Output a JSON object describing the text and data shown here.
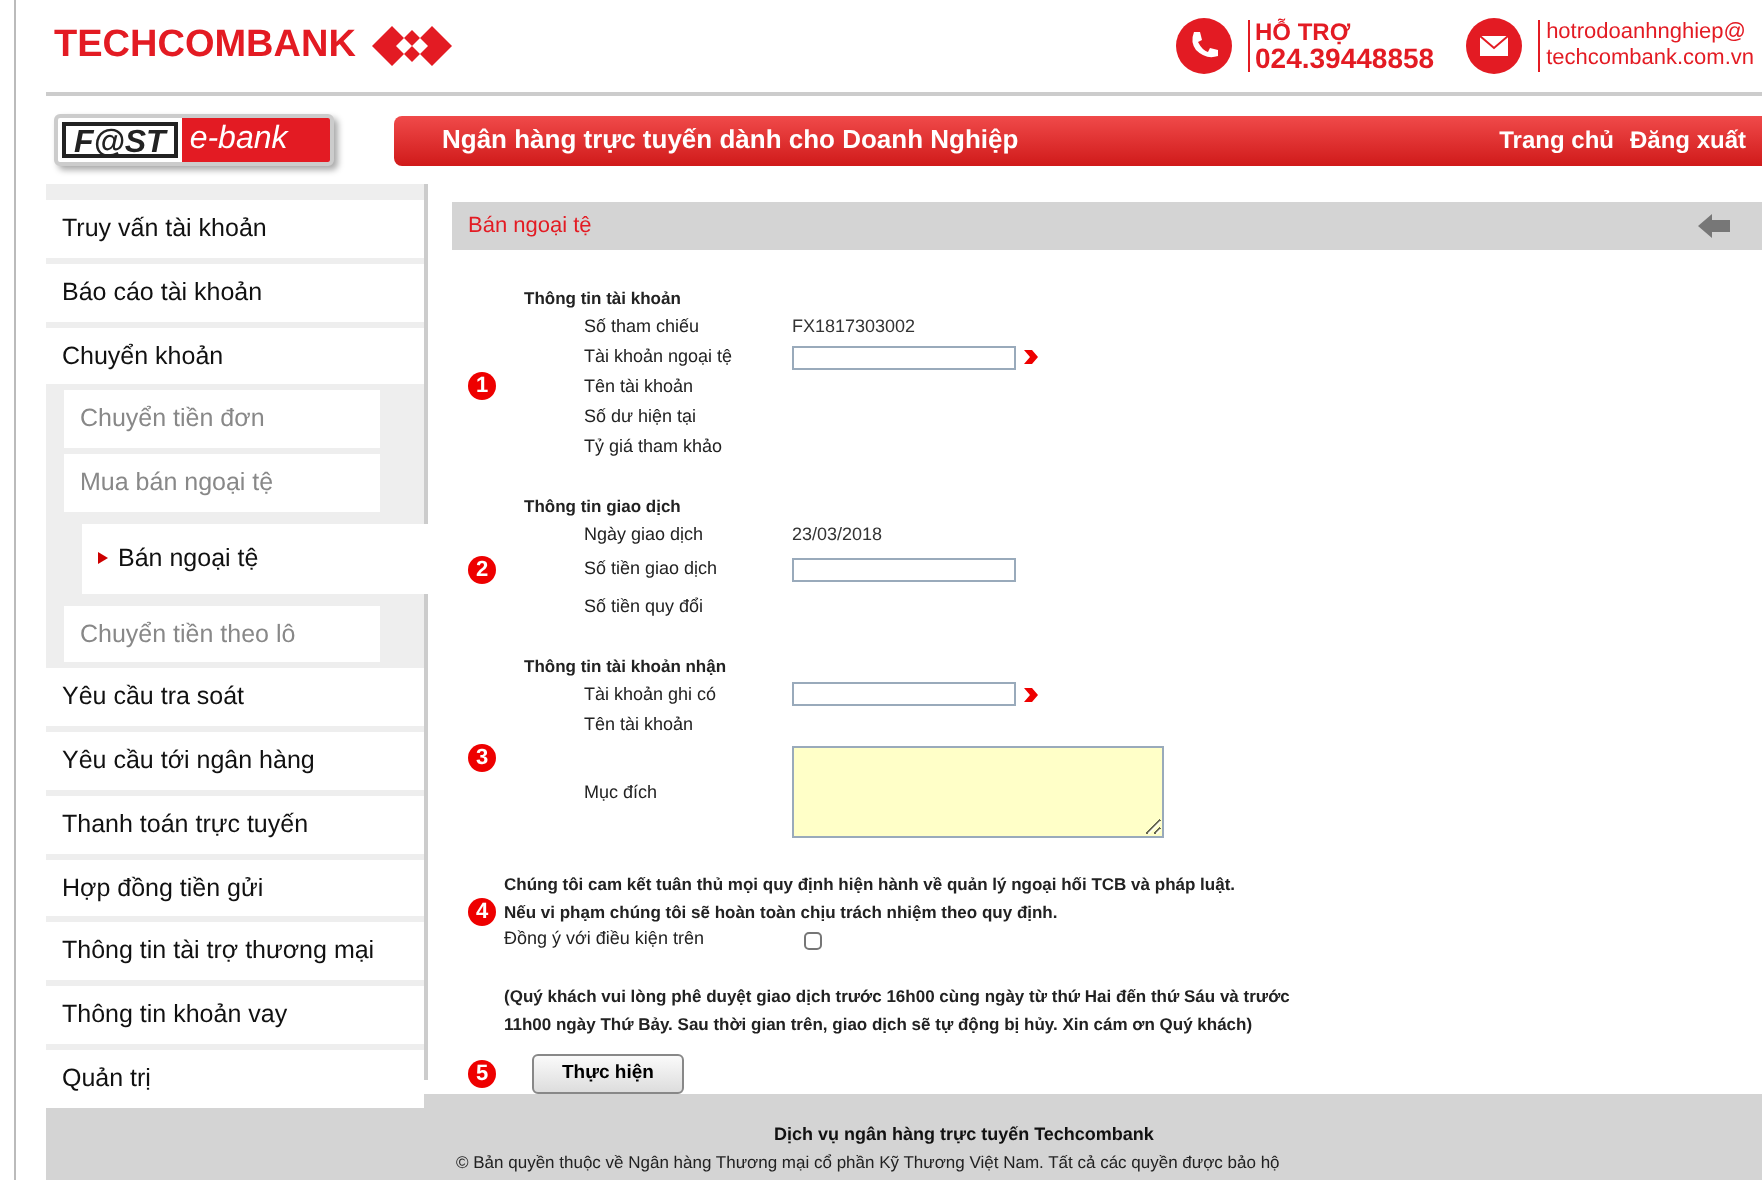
{
  "header": {
    "bank_name": "TECHCOMBANK",
    "support_label": "HỖ TRỢ",
    "support_phone": "024.39448858",
    "email_line_1": "hotrodoanhnghiep@",
    "email_line_2": "techcombank.com.vn"
  },
  "banner": {
    "logo_left": "F@ST",
    "logo_right": "e-bank",
    "tagline": "Ngân hàng trực tuyến dành cho Doanh Nghiệp",
    "links": [
      "Trang chủ",
      "Đăng xuất"
    ]
  },
  "sidebar": {
    "items": [
      {
        "label": "Truy vấn tài khoản",
        "selected": false
      },
      {
        "label": "Báo cáo tài khoản",
        "selected": false
      },
      {
        "label": "Chuyển khoản",
        "selected": false,
        "children": [
          {
            "label": "Chuyển tiền đơn",
            "selected": false
          },
          {
            "label": "Mua bán ngoại tệ",
            "selected": false,
            "children": [
              {
                "label": "Bán ngoại tệ",
                "selected": true
              }
            ]
          },
          {
            "label": "Chuyển tiền theo lô",
            "selected": false
          }
        ]
      },
      {
        "label": "Yêu cầu tra soát",
        "selected": false
      },
      {
        "label": "Yêu cầu tới ngân hàng",
        "selected": false
      },
      {
        "label": "Thanh toán trực tuyến",
        "selected": false
      },
      {
        "label": "Hợp đồng tiền gửi",
        "selected": false
      },
      {
        "label": "Thông tin tài trợ thương mại",
        "selected": false
      },
      {
        "label": "Thông tin khoản vay",
        "selected": false
      },
      {
        "label": "Quản trị",
        "selected": false
      }
    ]
  },
  "page_title": "Bán ngoại tệ",
  "sections": [
    {
      "step": "1",
      "title": "Thông tin tài khoản",
      "rows": [
        {
          "label": "Số tham chiếu",
          "kind": "text",
          "value": "FX1817303002"
        },
        {
          "label": "Tài khoản ngoại tệ",
          "kind": "lookup"
        },
        {
          "label": "Tên tài khoản",
          "kind": "empty"
        },
        {
          "label": "Số dư hiện tại",
          "kind": "empty"
        },
        {
          "label": "Tỷ giá tham khảo",
          "kind": "empty"
        }
      ]
    },
    {
      "step": "2",
      "title": "Thông tin giao dịch",
      "rows": [
        {
          "label": "Ngày giao dịch",
          "kind": "text",
          "value": "23/03/2018"
        },
        {
          "label": "Số tiền giao dịch",
          "kind": "input"
        },
        {
          "label": "Số tiền quy đổi",
          "kind": "empty"
        }
      ]
    },
    {
      "step": "3",
      "title": "Thông tin tài khoản nhận",
      "rows": [
        {
          "label": "Tài khoản ghi có",
          "kind": "lookup"
        },
        {
          "label": "Tên tài khoản",
          "kind": "empty"
        },
        {
          "label": "Mục đích",
          "kind": "textarea"
        }
      ]
    }
  ],
  "agreement": {
    "step": "4",
    "statement": [
      "Chúng tôi cam kết tuân thủ mọi quy định hiện hành về quản lý ngoại hối TCB và pháp luật.",
      "Nếu vi phạm chúng tôi sẽ hoàn toàn chịu trách nhiệm theo quy định."
    ],
    "checkbox_label": "Đồng ý với điều kiện trên",
    "checked": false,
    "note": [
      "(Quý khách vui lòng phê duyệt giao dịch trước 16h00 cùng ngày từ thứ Hai đến thứ Sáu và trước",
      "11h00 ngày Thứ Bảy. Sau thời gian trên, giao dịch sẽ tự động bị hủy. Xin cám ơn Quý khách)"
    ]
  },
  "submit": {
    "step": "5",
    "label": "Thực hiện"
  },
  "footer": {
    "title": "Dịch vụ ngân hàng trực tuyến Techcombank",
    "copyright": "© Bản quyền thuộc về Ngân hàng Thương mại cổ phần Kỹ Thương Việt Nam. Tất cả các quyền được bảo hộ"
  }
}
